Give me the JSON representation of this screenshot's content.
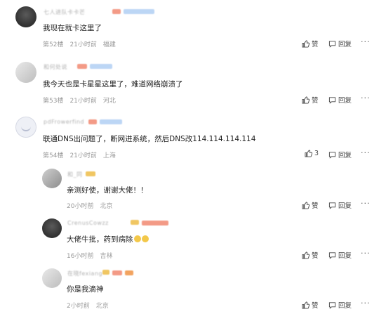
{
  "labels": {
    "like": "赞",
    "reply": "回复",
    "more": "···"
  },
  "comments": [
    {
      "name": "七人进队卡卡芒",
      "text": "我现在就卡这里了",
      "floor": "第52楼",
      "time": "21小时前",
      "location": "福建",
      "likes": ""
    },
    {
      "name": "和何处说",
      "text": "我今天也是卡星星这里了，难道网络崩溃了",
      "floor": "第53楼",
      "time": "21小时前",
      "location": "河北",
      "likes": ""
    },
    {
      "name": "pdFrowerfind",
      "text": "联通DNS出问题了，断网进系统，然后DNS改114.114.114.114",
      "floor": "第54楼",
      "time": "21小时前",
      "location": "上海",
      "likes": "3"
    }
  ],
  "replies": [
    {
      "name": "和_同",
      "text": "亲测好使，谢谢大佬！！",
      "time": "20小时前",
      "location": "北京"
    },
    {
      "name": "CrenusCowzz",
      "text": "大佬牛批，药到病除",
      "time": "16小时前",
      "location": "吉林"
    },
    {
      "name": "在晓fexiang",
      "text": "你是我滴神",
      "time": "2小时前",
      "location": "北京"
    }
  ]
}
